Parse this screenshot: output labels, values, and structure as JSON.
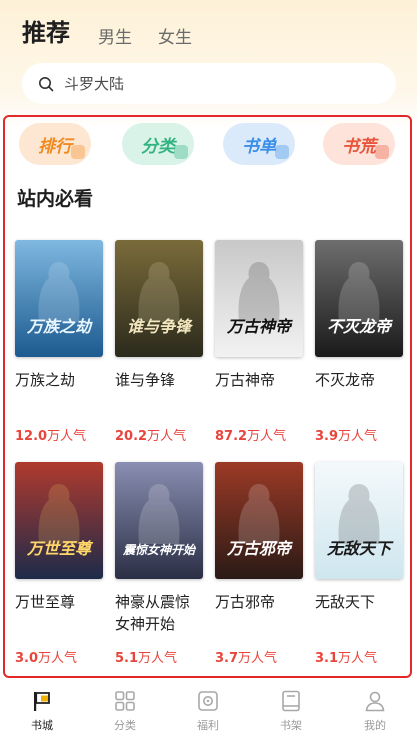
{
  "header": {
    "tabs": [
      {
        "label": "推荐",
        "active": true
      },
      {
        "label": "男生",
        "active": false
      },
      {
        "label": "女生",
        "active": false
      }
    ]
  },
  "search": {
    "placeholder": "斗罗大陆",
    "icon": "search-icon"
  },
  "categories": [
    {
      "label": "排行",
      "color": "#f08a1f",
      "bg": "#fde6d2"
    },
    {
      "label": "分类",
      "color": "#33b383",
      "bg": "#d9f3e8"
    },
    {
      "label": "书单",
      "color": "#3a8ee6",
      "bg": "#dbeafb"
    },
    {
      "label": "书荒",
      "color": "#e8553c",
      "bg": "#fde3d9"
    }
  ],
  "section": {
    "title": "站内必看"
  },
  "books": [
    {
      "title": "万族之劫",
      "popularity": "12.0",
      "unit": "万人气",
      "cover_text": "万族之劫",
      "cover_bg": "#1c5a8f",
      "cover_bg2": "#7fb8e0",
      "cover_fg": "#e8f6ff"
    },
    {
      "title": "谁与争锋",
      "popularity": "20.2",
      "unit": "万人气",
      "cover_text": "谁与争锋",
      "cover_bg": "#2b2a1c",
      "cover_bg2": "#7a6b3a",
      "cover_fg": "#f3e7c0"
    },
    {
      "title": "万古神帝",
      "popularity": "87.2",
      "unit": "万人气",
      "cover_text": "万古神帝",
      "cover_bg": "#f2f2f2",
      "cover_bg2": "#c8c8c8",
      "cover_fg": "#111111"
    },
    {
      "title": "不灭龙帝",
      "popularity": "3.9",
      "unit": "万人气",
      "cover_text": "不灭龙帝",
      "cover_bg": "#1a1a1a",
      "cover_bg2": "#6e6e6e",
      "cover_fg": "#ffffff"
    },
    {
      "title": "万世至尊",
      "popularity": "3.0",
      "unit": "万人气",
      "cover_text": "万世至尊",
      "cover_bg": "#1d2b4a",
      "cover_bg2": "#b03a2e",
      "cover_fg": "#ffd86b"
    },
    {
      "title": "神豪从震惊女神开始",
      "popularity": "5.1",
      "unit": "万人气",
      "cover_text": "震惊女神开始",
      "cover_bg": "#2a2f45",
      "cover_bg2": "#8a8fb3",
      "cover_fg": "#ffffff"
    },
    {
      "title": "万古邪帝",
      "popularity": "3.7",
      "unit": "万人气",
      "cover_text": "万古邪帝",
      "cover_bg": "#2a1a16",
      "cover_bg2": "#9c3a26",
      "cover_fg": "#ffffff"
    },
    {
      "title": "无敌天下",
      "popularity": "3.1",
      "unit": "万人气",
      "cover_text": "无敌天下",
      "cover_bg": "#cfe6ef",
      "cover_bg2": "#f4f9fb",
      "cover_fg": "#1a1a1a"
    }
  ],
  "bottom_nav": [
    {
      "label": "书城",
      "icon": "bookstore-icon",
      "active": true
    },
    {
      "label": "分类",
      "icon": "grid-icon",
      "active": false
    },
    {
      "label": "福利",
      "icon": "gift-icon",
      "active": false
    },
    {
      "label": "书架",
      "icon": "bookshelf-icon",
      "active": false
    },
    {
      "label": "我的",
      "icon": "profile-icon",
      "active": false
    }
  ]
}
